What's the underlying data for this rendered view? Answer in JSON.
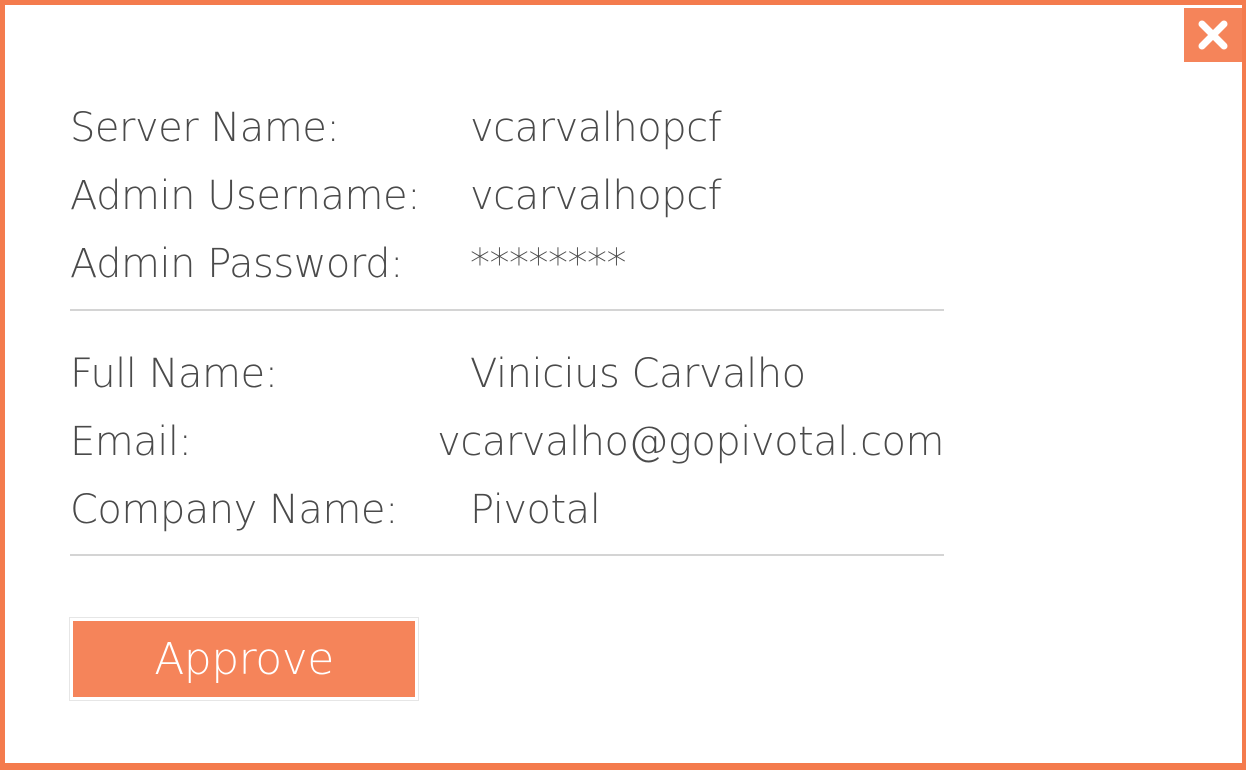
{
  "server_info": {
    "rows": [
      {
        "label": "Server Name:",
        "value": "vcarvalhopcf"
      },
      {
        "label": "Admin Username:",
        "value": "vcarvalhopcf"
      },
      {
        "label": "Admin Password:",
        "value": "********"
      }
    ]
  },
  "user_info": {
    "rows": [
      {
        "label": "Full Name:",
        "value": "Vinicius Carvalho"
      },
      {
        "label": "Email:",
        "value": "vcarvalho@gopivotal.com"
      },
      {
        "label": "Company Name:",
        "value": "Pivotal"
      }
    ]
  },
  "actions": {
    "approve_label": "Approve",
    "close_icon": "close-icon"
  },
  "colors": {
    "accent": "#f5845a",
    "border": "#f47b4d",
    "text": "#4a4a4a",
    "divider": "#d4d4d4"
  }
}
